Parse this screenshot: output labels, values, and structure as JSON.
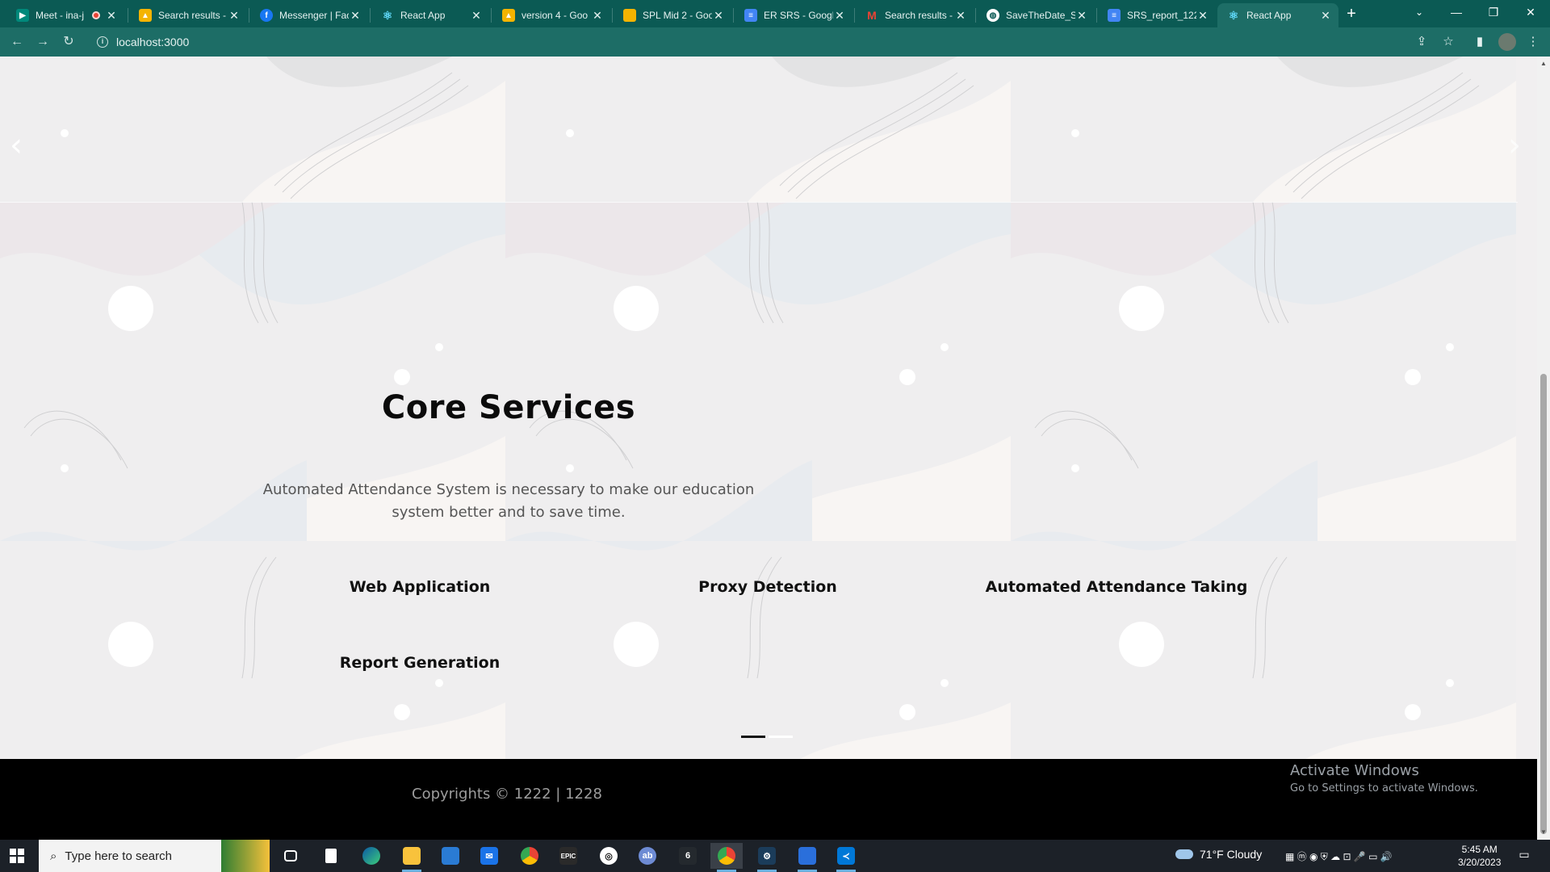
{
  "browser": {
    "tabs": [
      {
        "title": "Meet - ina-j",
        "favicon": "meet-icon",
        "color": "#00897b",
        "recording": true
      },
      {
        "title": "Search results -",
        "favicon": "google-drive-icon",
        "color": "#f4b400"
      },
      {
        "title": "Messenger | Fac",
        "favicon": "facebook-icon",
        "color": "#1877f2"
      },
      {
        "title": "React App",
        "favicon": "react-icon",
        "color": "#61dafb"
      },
      {
        "title": "version 4 - Goo",
        "favicon": "google-drive-icon",
        "color": "#f4b400"
      },
      {
        "title": "SPL Mid 2 - Goo",
        "favicon": "google-slides-icon",
        "color": "#f4b400"
      },
      {
        "title": "ER SRS - Google",
        "favicon": "google-docs-icon",
        "color": "#4285f4"
      },
      {
        "title": "Search results -",
        "favicon": "gmail-icon",
        "color": "#ea4335"
      },
      {
        "title": "SaveTheDate_SI",
        "favicon": "globe-icon",
        "color": "#ffffff"
      },
      {
        "title": "SRS_report_122",
        "favicon": "google-docs-icon",
        "color": "#4285f4"
      },
      {
        "title": "React App",
        "favicon": "react-icon",
        "color": "#61dafb",
        "active": true
      }
    ],
    "url": "localhost:3000"
  },
  "hero": {
    "prev_arrow": "‹",
    "next_arrow": "›"
  },
  "core": {
    "title": "Core Services",
    "description": "Automated Attendance System is necessary to make our education system better and to save time."
  },
  "services": [
    "Web Application",
    "Proxy Detection",
    "Automated Attendance Taking",
    "Report Generation"
  ],
  "carousel": {
    "slides": 2,
    "active_slide": 1
  },
  "footer": {
    "copyright": "Copyrights © 1222 | 1228"
  },
  "watermark": {
    "title": "Activate Windows",
    "subtitle": "Go to Settings to activate Windows."
  },
  "taskbar": {
    "search_placeholder": "Type here to search",
    "weather": "71°F  Cloudy",
    "time": "5:45 AM",
    "date": "3/20/2023",
    "apps": [
      "task-view-icon",
      "notepad-icon",
      "edge-icon",
      "file-explorer-icon",
      "store-icon",
      "mail-icon",
      "chrome-icon",
      "epic-games-icon",
      "obs-icon",
      "app-icon",
      "github-icon",
      "chrome-icon",
      "cisco-packet-tracer-icon",
      "photos-icon",
      "vscode-icon"
    ]
  },
  "colors": {
    "chrome_dark": "#0b5a54",
    "chrome_light": "#1d6d66",
    "footer_bg": "#000000",
    "page_bg": "#f1eff0"
  }
}
